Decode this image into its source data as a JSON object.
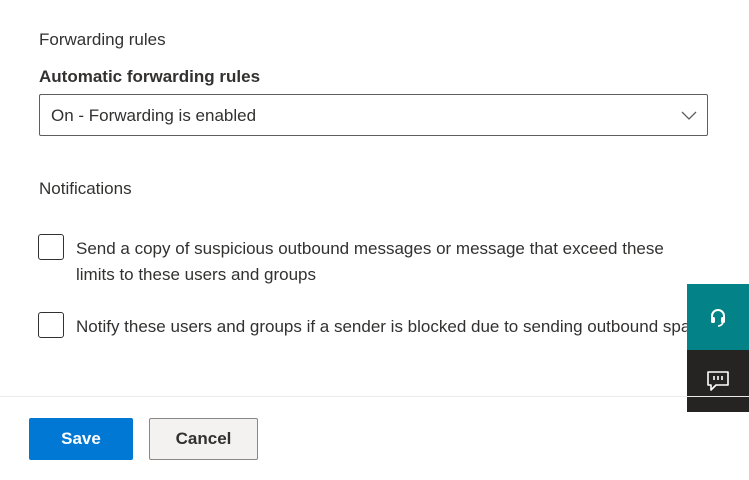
{
  "forwarding": {
    "section_title": "Forwarding rules",
    "field_label": "Automatic forwarding rules",
    "selected_value": "On - Forwarding is enabled"
  },
  "notifications": {
    "section_title": "Notifications",
    "options": [
      {
        "label": "Send a copy of suspicious outbound messages or message that exceed these limits to these users and groups",
        "checked": false
      },
      {
        "label": "Notify these users and groups if a sender is blocked due to sending outbound spam",
        "checked": false
      }
    ]
  },
  "actions": {
    "save_label": "Save",
    "cancel_label": "Cancel"
  },
  "side_panel": {
    "help_icon": "headset-icon",
    "feedback_icon": "feedback-icon"
  },
  "colors": {
    "accent": "#0078d4",
    "help_bg": "#038387",
    "feedback_bg": "#252423"
  }
}
